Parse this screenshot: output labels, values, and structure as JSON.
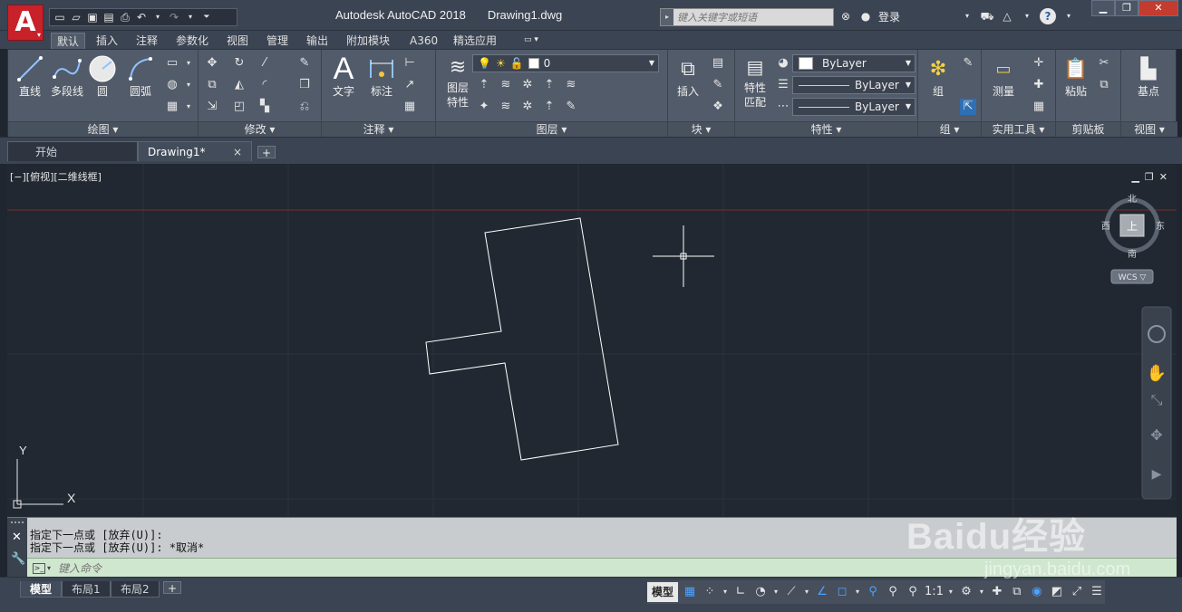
{
  "title": {
    "app": "Autodesk AutoCAD 2018",
    "file": "Drawing1.dwg",
    "app_logo": "A"
  },
  "search": {
    "placeholder": "键入关键字或短语"
  },
  "account": {
    "login": "登录",
    "help": "?"
  },
  "ribbon_tabs": [
    "默认",
    "插入",
    "注释",
    "参数化",
    "视图",
    "管理",
    "输出",
    "附加模块",
    "A360",
    "精选应用"
  ],
  "ribbon": {
    "draw": {
      "line": "直线",
      "polyline": "多段线",
      "circle": "圆",
      "arc": "圆弧",
      "footer": "绘图 ▾"
    },
    "modify": {
      "footer": "修改 ▾"
    },
    "annotation": {
      "text": "文字",
      "dimension": "标注",
      "footer": "注释 ▾"
    },
    "layers": {
      "layer_props_1": "图层",
      "layer_props_2": "特性",
      "current_layer": "0",
      "footer": "图层 ▾"
    },
    "block": {
      "insert": "插入",
      "footer": "块 ▾"
    },
    "properties": {
      "match_1": "特性",
      "match_2": "匹配",
      "color": "ByLayer",
      "linetype": "ByLayer",
      "lineweight": "ByLayer",
      "footer": "特性 ▾"
    },
    "groups": {
      "group": "组",
      "footer": "组 ▾"
    },
    "utilities": {
      "measure": "测量",
      "footer": "实用工具 ▾"
    },
    "clipboard": {
      "paste": "粘贴",
      "footer": "剪贴板"
    },
    "view": {
      "base": "基点",
      "footer": "视图 ▾"
    }
  },
  "file_tabs": {
    "start": "开始",
    "drawing": "Drawing1*",
    "close": "×",
    "add": "+"
  },
  "viewport": {
    "label": "[−][俯视][二维线框]",
    "compass": {
      "north": "北",
      "south": "南",
      "east": "东",
      "west": "西",
      "top": "上"
    },
    "wcs": "WCS ▽",
    "ucs_x": "X",
    "ucs_y": "Y"
  },
  "command": {
    "history": [
      "指定下一点或 [放弃(U)]:",
      "指定下一点或 [放弃(U)]: *取消*"
    ],
    "placeholder": "键入命令"
  },
  "layout_tabs": [
    "模型",
    "布局1",
    "布局2"
  ],
  "status": {
    "model": "模型",
    "scale": "1:1"
  },
  "watermark": {
    "brand": "Baidu经验",
    "url": "jingyan.baidu.com"
  },
  "colors": {
    "canvas": "#212831",
    "ui_dark": "#3b4453",
    "ribbon": "#525b69",
    "logo_red": "#c8212a",
    "command_green": "#cfe6cf",
    "axis_red": "#7a2b2b"
  }
}
